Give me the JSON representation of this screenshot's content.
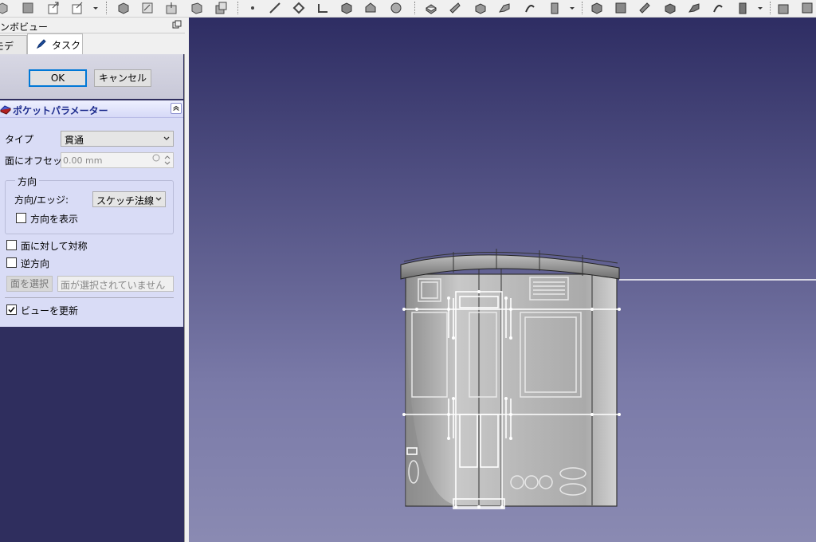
{
  "panel": {
    "title": "ンボビュー",
    "tabs": [
      {
        "label": "モデル"
      },
      {
        "label": "タスク"
      }
    ],
    "buttons": {
      "ok": "OK",
      "cancel": "キャンセル"
    }
  },
  "pocket": {
    "title": "ポケットパラメーター",
    "type_label": "タイプ",
    "type_value": "貫通",
    "offset_label": "面にオフセット",
    "offset_value": "0.00 mm",
    "direction_group": "方向",
    "direction_edge_label": "方向/エッジ:",
    "direction_edge_value": "スケッチ法線",
    "show_direction_label": "方向を表示",
    "show_direction_checked": false,
    "symmetric_label": "面に対して対称",
    "symmetric_checked": false,
    "reversed_label": "逆方向",
    "reversed_checked": false,
    "select_face_button": "面を選択",
    "no_face_text": "面が選択されていません",
    "update_view_label": "ビューを更新",
    "update_view_checked": true
  },
  "icons": [
    "open-icon",
    "save-icon",
    "export-icon",
    "box-icon",
    "pad-icon",
    "pocket-icon",
    "sketch-icon",
    "line-icon",
    "fillet-icon",
    "chamfer-icon",
    "datum-icon",
    "collapse-icon",
    "float-icon"
  ]
}
